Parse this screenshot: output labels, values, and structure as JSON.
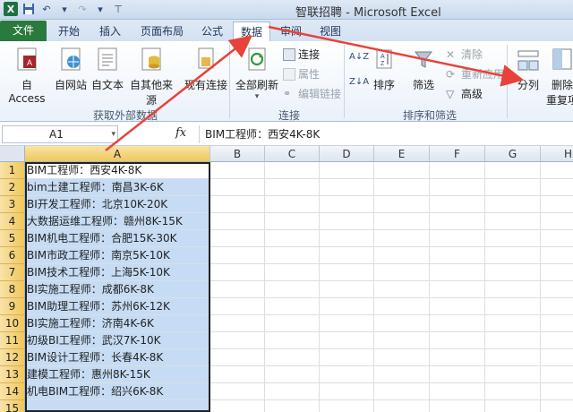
{
  "window": {
    "title": "智联招聘 - Microsoft Excel",
    "app_icon": "X"
  },
  "tabs": [
    {
      "label": "文件"
    },
    {
      "label": "开始"
    },
    {
      "label": "插入"
    },
    {
      "label": "页面布局"
    },
    {
      "label": "公式"
    },
    {
      "label": "数据"
    },
    {
      "label": "审阅"
    },
    {
      "label": "视图"
    }
  ],
  "active_tab": "数据",
  "ribbon": {
    "get_external": {
      "from_access": "自 Access",
      "from_web": "自网站",
      "from_text": "自文本",
      "from_other": "自其他来源",
      "existing": "现有连接",
      "group_label": "获取外部数据"
    },
    "connections": {
      "refresh_all": "全部刷新",
      "connections": "连接",
      "properties": "属性",
      "edit_links": "编辑链接",
      "group_label": "连接"
    },
    "sort_filter": {
      "sort": "排序",
      "filter": "筛选",
      "clear": "清除",
      "reapply": "重新应用",
      "advanced": "高级",
      "group_label": "排序和筛选"
    },
    "data_tools": {
      "text_to_columns": "分列",
      "remove_duplicates_1": "删除",
      "remove_duplicates_2": "重复项"
    }
  },
  "formula_bar": {
    "name_box": "A1",
    "fx_label": "fx",
    "content": "BIM工程师：西安4K-8K"
  },
  "columns": [
    "A",
    "B",
    "C",
    "D",
    "E",
    "F",
    "G",
    "H"
  ],
  "rows": [
    {
      "num": "1",
      "a": "BIM工程师：西安4K-8K"
    },
    {
      "num": "2",
      "a": "bim土建工程师：南昌3K-6K"
    },
    {
      "num": "3",
      "a": "BI开发工程师：北京10K-20K"
    },
    {
      "num": "4",
      "a": "大数据运维工程师：赣州8K-15K"
    },
    {
      "num": "5",
      "a": "BIM机电工程师：合肥15K-30K"
    },
    {
      "num": "6",
      "a": "BIM市政工程师：南京5K-10K"
    },
    {
      "num": "7",
      "a": "BIM技术工程师：上海5K-10K"
    },
    {
      "num": "8",
      "a": "BI实施工程师：成都6K-8K"
    },
    {
      "num": "9",
      "a": "BIM助理工程师：苏州6K-12K"
    },
    {
      "num": "10",
      "a": "BI实施工程师：济南4K-6K"
    },
    {
      "num": "11",
      "a": "初级BI工程师：武汉7K-10K"
    },
    {
      "num": "12",
      "a": "BIM设计工程师：长春4K-8K"
    },
    {
      "num": "13",
      "a": "建模工程师：惠州8K-15K"
    },
    {
      "num": "14",
      "a": "机电BIM工程师：绍兴6K-8K"
    },
    {
      "num": "15",
      "a": ""
    }
  ],
  "colors": {
    "file_tab": "#2a7a3d",
    "selection_fill": "#c6dcf4",
    "header_highlight": "#f0c75a",
    "annotation_arrow": "#e8423a"
  }
}
